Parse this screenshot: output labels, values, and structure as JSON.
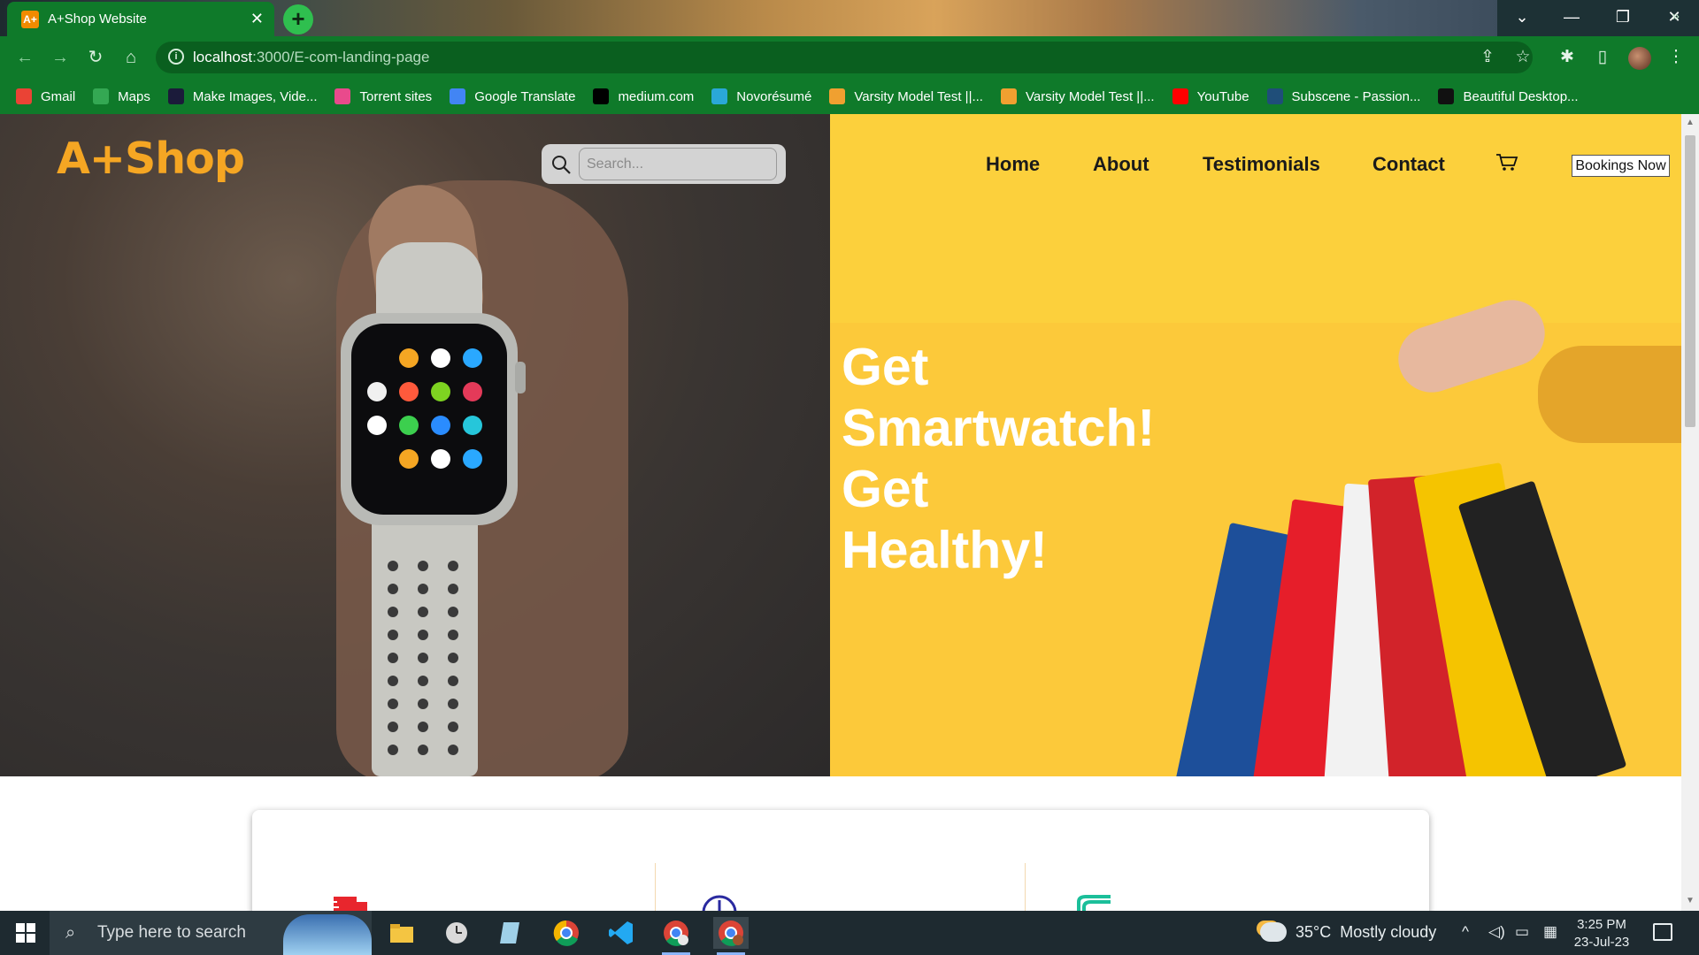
{
  "browser": {
    "tab_title": "A+Shop Website",
    "tab_favicon": "A+",
    "url_host": "localhost",
    "url_path": ":3000/E-com-landing-page",
    "bookmarks": [
      {
        "label": "Gmail",
        "icon": "gmail-icon",
        "color": "#ea4335"
      },
      {
        "label": "Maps",
        "icon": "maps-icon",
        "color": "#34a853"
      },
      {
        "label": "Make Images, Vide...",
        "icon": "picsart-icon",
        "color": "#1b1b3a"
      },
      {
        "label": "Torrent sites",
        "icon": "tf-icon",
        "color": "#e94a8c"
      },
      {
        "label": "Google Translate",
        "icon": "translate-icon",
        "color": "#4285f4"
      },
      {
        "label": "medium.com",
        "icon": "medium-icon",
        "color": "#000000"
      },
      {
        "label": "Novorésumé",
        "icon": "novoresume-icon",
        "color": "#2aa8d8"
      },
      {
        "label": "Varsity Model Test ||...",
        "icon": "varsity-icon",
        "color": "#f0a030"
      },
      {
        "label": "Varsity Model Test ||...",
        "icon": "varsity-icon",
        "color": "#f0a030"
      },
      {
        "label": "YouTube",
        "icon": "youtube-icon",
        "color": "#ff0000"
      },
      {
        "label": "Subscene - Passion...",
        "icon": "subscene-icon",
        "color": "#1f4e79"
      },
      {
        "label": "Beautiful Desktop...",
        "icon": "wt-icon",
        "color": "#111111"
      }
    ]
  },
  "site": {
    "logo": "A+Shop",
    "search_placeholder": "Search...",
    "nav": [
      "Home",
      "About",
      "Testimonials",
      "Contact"
    ],
    "booking_button": "Bookings Now",
    "headline": [
      "Get",
      "Smartwatch!",
      "Get",
      "Healthy!"
    ]
  },
  "taskbar": {
    "search_placeholder": "Type here to search",
    "weather_temp": "35°C",
    "weather_desc": "Mostly cloudy",
    "time": "3:25 PM",
    "date": "23-Jul-23"
  },
  "colors": {
    "brand": "#f5a623",
    "hero_right": "#fcd03c",
    "chrome": "#0f7a2a"
  }
}
